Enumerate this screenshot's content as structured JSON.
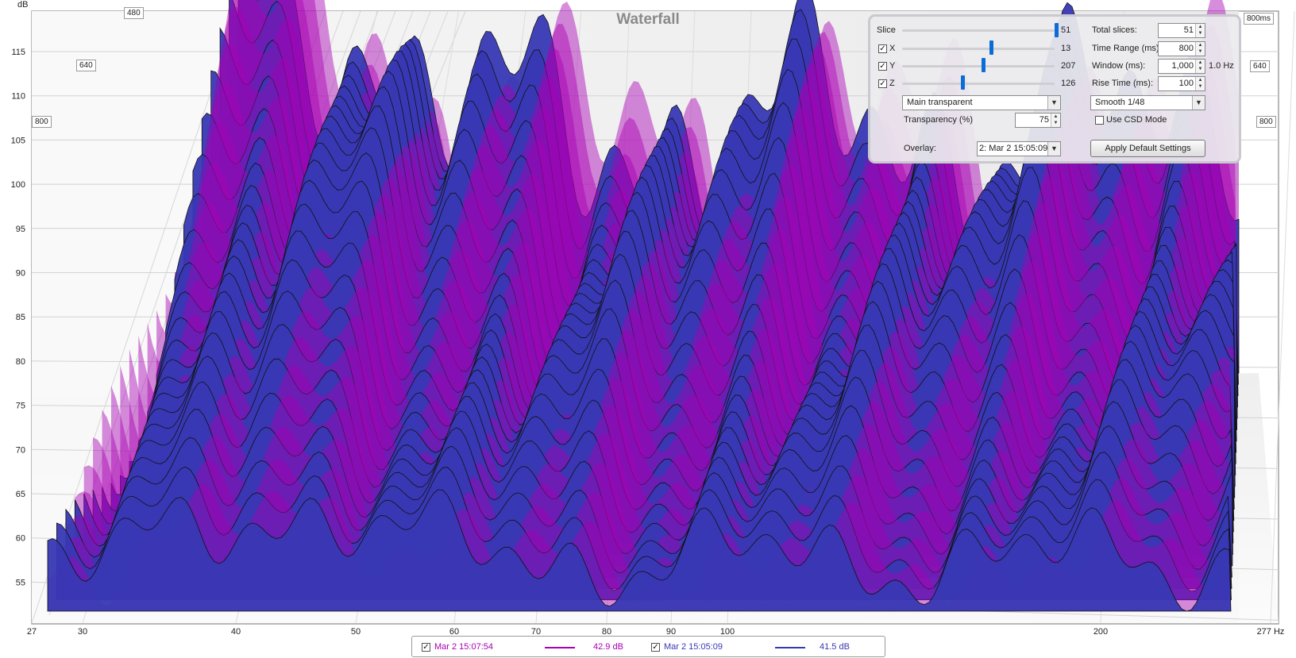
{
  "window_title": "Waterfall",
  "plot": {
    "y_unit": "dB",
    "y_ticks": [
      "115",
      "110",
      "105",
      "100",
      "95",
      "90",
      "85",
      "80",
      "75",
      "70",
      "65",
      "60",
      "55"
    ],
    "x_ticks": [
      "27",
      "30",
      "40",
      "50",
      "60",
      "70",
      "80",
      "90",
      "100",
      "200",
      "277 Hz"
    ],
    "time_labels_left": [
      "480",
      "640",
      "800"
    ],
    "time_labels_right": [
      "800ms",
      "640",
      "800"
    ],
    "colors": {
      "current": "#a800b4",
      "overlay": "#3838b4",
      "background": "#f2f2f2"
    }
  },
  "controls": {
    "slice": {
      "label": "Slice",
      "value": "51"
    },
    "x_axis": {
      "label": "X",
      "checked": true,
      "value": "13"
    },
    "y_axis": {
      "label": "Y",
      "checked": true,
      "value": "207"
    },
    "z_axis": {
      "label": "Z",
      "checked": true,
      "value": "126"
    },
    "total_slices": {
      "label": "Total slices:",
      "value": "51"
    },
    "time_range": {
      "label": "Time Range (ms):",
      "value": "800"
    },
    "window": {
      "label": "Window (ms):",
      "value": "1,000",
      "resolution": "1.0 Hz"
    },
    "rise_time": {
      "label": "Rise Time (ms):",
      "value": "100"
    },
    "display_mode": "Main transparent",
    "smoothing": "Smooth 1/48",
    "transparency": {
      "label": "Transparency (%)",
      "value": "75"
    },
    "csd_mode": {
      "label": "Use CSD Mode",
      "checked": false
    },
    "overlay": {
      "label": "Overlay:",
      "value": "2: Mar 2 15:05:09"
    },
    "apply_defaults_label": "Apply Default Settings"
  },
  "legend": [
    {
      "name": "Mar 2 15:07:54",
      "value": "42.9 dB",
      "color": "#a800b4",
      "checked": true
    },
    {
      "name": "Mar 2 15:05:09",
      "value": "41.5 dB",
      "color": "#3838b4",
      "checked": true
    }
  ]
}
